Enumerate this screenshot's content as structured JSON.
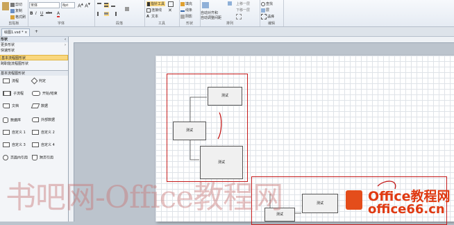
{
  "ribbon": {
    "clipboard": {
      "paste_icon": "paste-icon",
      "cut": "剪切",
      "copy": "复制",
      "format": "格式刷",
      "label": "剪贴板"
    },
    "font": {
      "name": "宋体",
      "size": "8pt",
      "bold": "B",
      "italic": "I",
      "underline": "U",
      "strike": "abc",
      "label": "字体"
    },
    "paragraph": {
      "label": "段落"
    },
    "tools": {
      "pointer": "指针工具",
      "connector": "连接线",
      "text": "文本",
      "label": "工具"
    },
    "shape": {
      "fill": "填充",
      "line": "线条",
      "shadow": "阴影",
      "label": "形状"
    },
    "arrange": {
      "auto_align": "自动对齐和",
      "auto_space": "自动调整间距",
      "bring_forward": "上移一层",
      "send_backward": "下移一层",
      "label": "排列"
    },
    "editing": {
      "find": "查找",
      "layers": "层",
      "select": "选择",
      "label": "编辑"
    }
  },
  "document_tab": {
    "name": "绘图1.vsd *"
  },
  "shapes_panel": {
    "title": "形状",
    "more_shapes": "更多形状",
    "quick_shapes": "快速形状",
    "basic_flowchart": "基本流程图形状",
    "cross_functional": "跨职能流程图形状",
    "stencil_title": "基本流程图形状",
    "shapes": [
      {
        "left": "流程",
        "right": "判定"
      },
      {
        "left": "子流程",
        "right": "开始/结束"
      },
      {
        "left": "文档",
        "right": "数据"
      },
      {
        "left": "数据库",
        "right": "外部数据"
      },
      {
        "left": "自定义 1",
        "right": "自定义 2"
      },
      {
        "left": "自定义 3",
        "right": "自定义 4"
      },
      {
        "left": "页面内引用",
        "right": "跨页引用"
      }
    ]
  },
  "diagram": {
    "node_a": "测试",
    "node_b": "测试",
    "node_c": "测试",
    "node_d": "测试",
    "node_e": "测试"
  },
  "watermark": {
    "text": "书吧网-Office教程网",
    "logo_line1": "Office教程网",
    "logo_line2": "office66.cn"
  },
  "colors": {
    "highlight": "#f9d77e",
    "red_annotation": "#c41a1a",
    "page": "#ffffff",
    "workspace": "#bcc4cd"
  }
}
